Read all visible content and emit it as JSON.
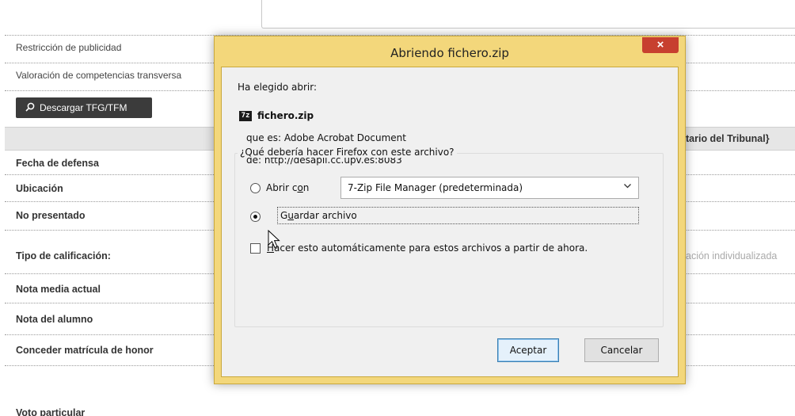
{
  "form": {
    "restriccion_label": "Restricción de publicidad",
    "valoracion_label": "Valoración de competencias transversa",
    "download_button": "Descargar TFG/TFM",
    "tribunal_header": "tario del Tribunal}",
    "fecha_label": "Fecha de defensa",
    "ubicacion_label": "Ubicación",
    "no_presentado_label": "No presentado",
    "tipo_label": "Tipo de calificación:",
    "tipo_value": "ación individualizada",
    "nota_media_label": "Nota media actual",
    "nota_alumno_label": "Nota del alumno",
    "matricula_label": "Conceder matrícula de honor",
    "voto_label": "Voto particular"
  },
  "dialog": {
    "title": "Abriendo fichero.zip",
    "close_glyph": "×",
    "intro": "Ha elegido abrir:",
    "file_icon_text": "7z",
    "file_name": "fichero.zip",
    "type_line": "que es:  Adobe Acrobat Document",
    "from_line": "de:  http://desapli.cc.upv.es:8083",
    "question": "¿Qué debería hacer Firefox con este archivo?",
    "open_with_pre": "Abrir c",
    "open_with_key": "o",
    "open_with_post": "n",
    "open_with_app": "7-Zip File Manager (predeterminada)",
    "save_pre": "G",
    "save_key": "u",
    "save_post": "ardar archivo",
    "auto_key": "H",
    "auto_post": "acer esto automáticamente para estos archivos a partir de ahora.",
    "accept_button": "Aceptar",
    "cancel_button": "Cancelar"
  },
  "colors": {
    "dialog_frame": "#f3d77b",
    "close_button": "#c7402f",
    "download_button": "#3b3b3b"
  },
  "icons": [
    "search-icon",
    "close-icon",
    "zip-file-icon",
    "chevron-down-icon",
    "mouse-cursor-icon"
  ]
}
